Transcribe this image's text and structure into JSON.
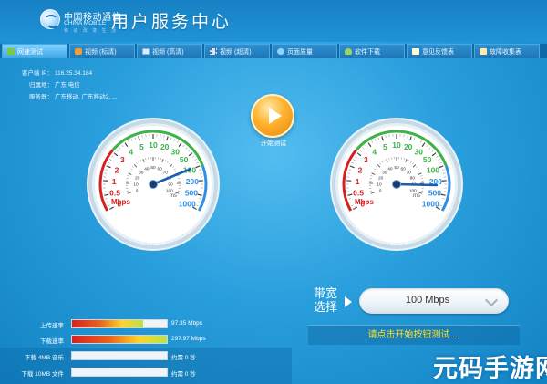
{
  "header": {
    "logo_cn": "中国移动通信",
    "logo_en": "CHINA MOBILE",
    "logo_sub": "移 动 改 变 生 活",
    "title": "用户服务中心"
  },
  "tabs": [
    {
      "label": "网速测试",
      "icon": "speed-icon",
      "active": true
    },
    {
      "label": "视频 (标清)",
      "icon": "video-icon",
      "active": false
    },
    {
      "label": "视频 (高清)",
      "icon": "monitor-icon",
      "active": false
    },
    {
      "label": "视频 (超清)",
      "icon": "film-icon",
      "active": false
    },
    {
      "label": "页面质量",
      "icon": "globe-icon",
      "active": false
    },
    {
      "label": "软件下载",
      "icon": "download-icon",
      "active": false
    },
    {
      "label": "意见反馈表",
      "icon": "feedback-icon",
      "active": false
    },
    {
      "label": "故障收集表",
      "icon": "report-icon",
      "active": false
    }
  ],
  "client_info": {
    "ip_label": "客户端 IP：",
    "ip": "116.25.34.184",
    "loc_label": "归属地：",
    "loc": "广东 电信",
    "server_label": "服务器：",
    "server": "广东移动, 广东移动2, ..."
  },
  "start": {
    "label": "开始测试"
  },
  "upload_gauge": {
    "speed_text": "97.35 Mbps",
    "name": "上传速率",
    "unit_mbps": "Mbps",
    "unit_ms": "ms",
    "scale_labels": [
      "0",
      "0.5",
      "1",
      "2",
      "3",
      "4",
      "5",
      "10",
      "20",
      "30",
      "50",
      "100",
      "200",
      "500",
      "1000"
    ],
    "ping_labels": [
      "0",
      "10",
      "20",
      "30",
      "40",
      "50",
      "60",
      "70",
      "80",
      "90",
      "100"
    ],
    "needle_value": 97.35
  },
  "download_gauge": {
    "speed_text": "297.97 Mbps",
    "name": "下载速率",
    "unit_mbps": "Mbps",
    "unit_ms": "ms",
    "scale_labels": [
      "0",
      "0.5",
      "1",
      "2",
      "3",
      "4",
      "5",
      "10",
      "20",
      "30",
      "50",
      "100",
      "200",
      "500",
      "1000"
    ],
    "ping_labels": [
      "0",
      "10",
      "20",
      "30",
      "40",
      "50",
      "60",
      "70",
      "80",
      "90",
      "100"
    ],
    "needle_value": 297.97
  },
  "bandwidth": {
    "label": "带宽选择",
    "value": "100 Mbps"
  },
  "hint": "请点击开始按钮测试 ...",
  "rates": [
    {
      "label": "上传速率",
      "value": "97.35 Mbps",
      "fill": 0.75
    },
    {
      "label": "下载速率",
      "value": "297.97 Mbps",
      "fill": 1.0
    },
    {
      "label": "下载 4MB 音乐",
      "value": "约需 0 秒",
      "fill": 0
    },
    {
      "label": "下载 10MB 文件",
      "value": "约需 0 秒",
      "fill": 0
    }
  ],
  "watermark": "元码手游网",
  "colors": {
    "accent": "#1f93d6",
    "gauge_red": "#d62020",
    "gauge_green": "#3db34a",
    "gauge_blue": "#2f8fe8",
    "hint_yellow": "#ffe020"
  }
}
